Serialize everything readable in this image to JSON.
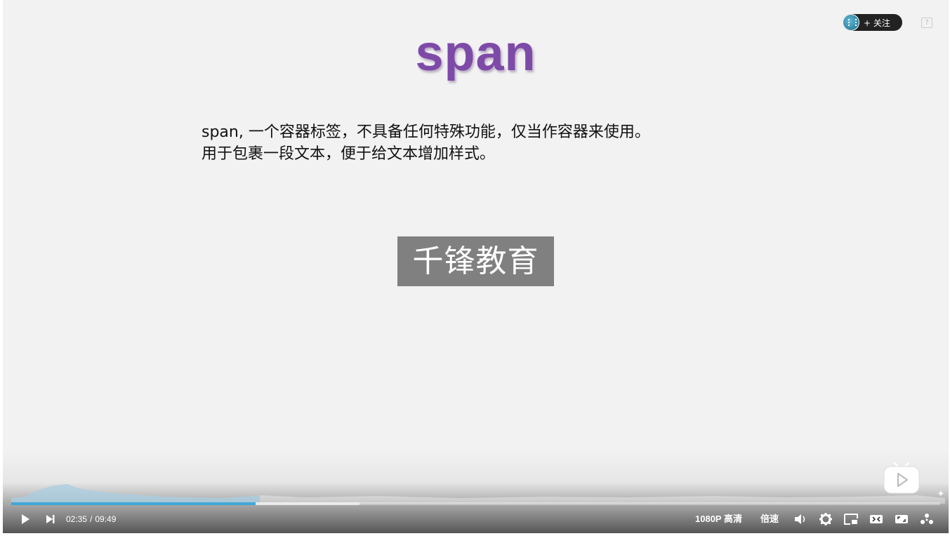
{
  "slide": {
    "title": "span",
    "lines": [
      "span, 一个容器标签，不具备任何特殊功能，仅当作容器来使用。",
      "用于包裹一段文本，便于给文本增加样式。"
    ],
    "watermark": "千锋教育"
  },
  "overlay": {
    "follow_label": "+ 关注",
    "help_label": "?"
  },
  "player": {
    "current_time": "02:35",
    "time_separator": "/",
    "duration": "09:49",
    "played_fraction": 0.263,
    "buffered_fraction": 0.375,
    "quality_label": "1080P 高清",
    "speed_label": "倍速",
    "accent_color": "#40a7d8",
    "title_color": "#7e4aa8"
  },
  "icons": {
    "play": "play-icon",
    "next": "next-icon",
    "volume": "volume-icon",
    "settings": "gear-icon",
    "pip": "picture-in-picture-icon",
    "widescreen": "widescreen-icon",
    "webfullscreen": "web-fullscreen-icon",
    "fullscreen": "fullscreen-icon"
  }
}
